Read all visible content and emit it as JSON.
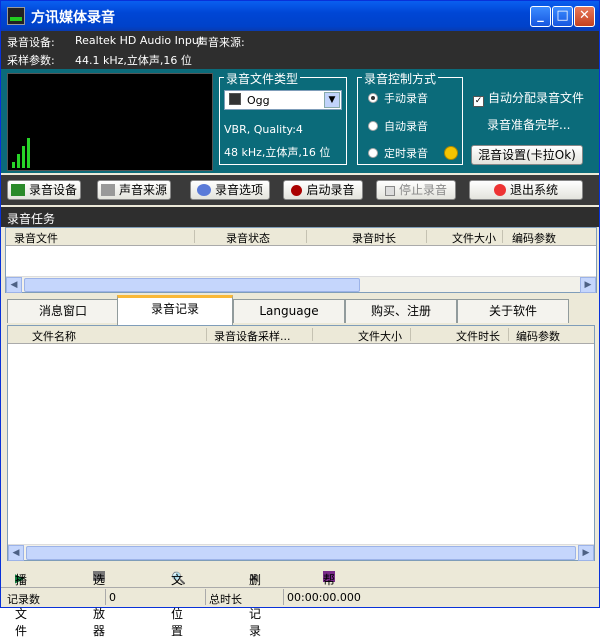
{
  "window": {
    "title": "方讯媒体录音"
  },
  "info": {
    "device_label": "录音设备:",
    "device_value": "Realtek HD Audio Input",
    "source_label": "声音来源:",
    "params_label": "采样参数:",
    "params_value": "44.1  kHz,立体声,16 位"
  },
  "filetype": {
    "legend": "录音文件类型",
    "format": "Ogg",
    "quality": "VBR, Quality:4",
    "params": "48   kHz,立体声,16 位"
  },
  "control": {
    "legend": "录音控制方式",
    "options": [
      "手动录音",
      "自动录音",
      "定时录音"
    ],
    "selected": 0
  },
  "options": {
    "auto_assign": "自动分配录音文件",
    "status_text": "录音准备完毕...",
    "mix_button": "混音设置(卡拉Ok)"
  },
  "toolbar": {
    "device": "录音设备",
    "source": "声音来源",
    "options": "录音选项",
    "start": "启动录音",
    "stop": "停止录音",
    "exit": "退出系统"
  },
  "tasks": {
    "title": "录音任务",
    "columns": [
      "录音文件",
      "录音状态",
      "录音时长",
      "文件大小",
      "编码参数"
    ]
  },
  "tabs": [
    "消息窗口",
    "录音记录",
    "Language",
    "购买、注册",
    "关于软件"
  ],
  "active_tab": 1,
  "records": {
    "columns": [
      "文件名称",
      "录音设备采样...",
      "文件大小",
      "文件时长",
      "编码参数"
    ]
  },
  "actions": {
    "play": "播放文件",
    "player": "选播放器",
    "locate": "文件位置",
    "delete": "删除记录",
    "help": "帮助"
  },
  "status": {
    "count_label": "记录数",
    "count_value": "0",
    "duration_label": "总时长",
    "duration_value": "00:00:00.000"
  },
  "colors": {
    "panel": "#0b6b7a",
    "dark": "#2e2e2e",
    "accent": "#0046d5"
  }
}
